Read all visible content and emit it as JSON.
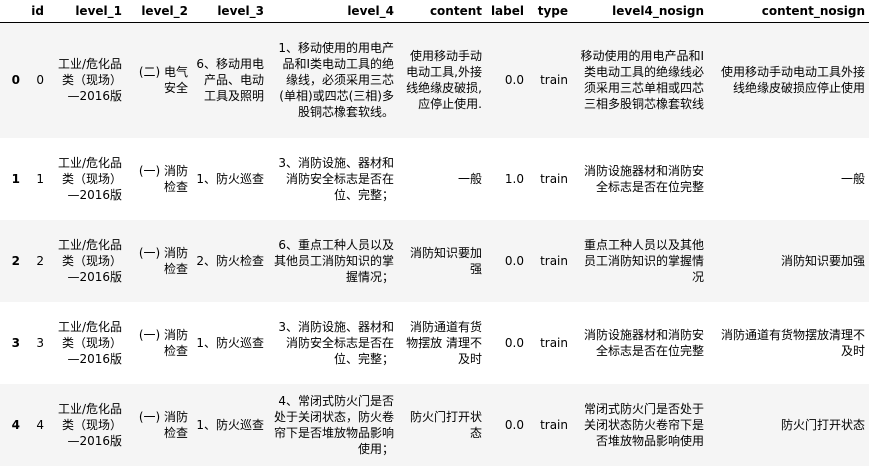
{
  "columns": [
    "",
    "id",
    "level_1",
    "level_2",
    "level_3",
    "level_4",
    "content",
    "label",
    "type",
    "level4_nosign",
    "content_nosign"
  ],
  "rows": [
    {
      "index": "0",
      "id": "0",
      "level_1": "工业/危化品类（现场）—2016版",
      "level_2": "(二) 电气安全",
      "level_3": "6、移动用电产品、电动工具及照明",
      "level_4": "1、移动使用的用电产品和I类电动工具的绝缘线，必须采用三芯(单相)或四芯(三相)多股铜芯橡套软线。",
      "content": "使用移动手动电动工具,外接线绝缘皮破损,应停止使用.",
      "label": "0.0",
      "type": "train",
      "level4_nosign": "移动使用的用电产品和I类电动工具的绝缘线必须采用三芯单相或四芯三相多股铜芯橡套软线",
      "content_nosign": "使用移动手动电动工具外接线绝缘皮破损应停止使用"
    },
    {
      "index": "1",
      "id": "1",
      "level_1": "工业/危化品类（现场）—2016版",
      "level_2": "(一) 消防检查",
      "level_3": "1、防火巡查",
      "level_4": "3、消防设施、器材和消防安全标志是否在位、完整；",
      "content": "一般",
      "label": "1.0",
      "type": "train",
      "level4_nosign": "消防设施器材和消防安全标志是否在位完整",
      "content_nosign": "一般"
    },
    {
      "index": "2",
      "id": "2",
      "level_1": "工业/危化品类（现场）—2016版",
      "level_2": "(一) 消防检查",
      "level_3": "2、防火检查",
      "level_4": "6、重点工种人员以及其他员工消防知识的掌握情况；",
      "content": "消防知识要加强",
      "label": "0.0",
      "type": "train",
      "level4_nosign": "重点工种人员以及其他员工消防知识的掌握情况",
      "content_nosign": "消防知识要加强"
    },
    {
      "index": "3",
      "id": "3",
      "level_1": "工业/危化品类（现场）—2016版",
      "level_2": "(一) 消防检查",
      "level_3": "1、防火巡查",
      "level_4": "3、消防设施、器材和消防安全标志是否在位、完整；",
      "content": "消防通道有货物摆放 清理不及时",
      "label": "0.0",
      "type": "train",
      "level4_nosign": "消防设施器材和消防安全标志是否在位完整",
      "content_nosign": "消防通道有货物摆放清理不及时"
    },
    {
      "index": "4",
      "id": "4",
      "level_1": "工业/危化品类（现场）—2016版",
      "level_2": "(一) 消防检查",
      "level_3": "1、防火巡查",
      "level_4": "4、常闭式防火门是否处于关闭状态，防火卷帘下是否堆放物品影响使用；",
      "content": "防火门打开状态",
      "label": "0.0",
      "type": "train",
      "level4_nosign": "常闭式防火门是否处于关闭状态防火卷帘下是否堆放物品影响使用",
      "content_nosign": "防火门打开状态"
    }
  ]
}
